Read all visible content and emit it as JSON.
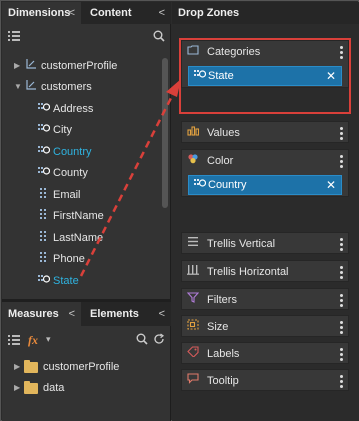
{
  "left": {
    "tabs": [
      {
        "label": "Dimensions",
        "chev": "<"
      },
      {
        "label": "Content",
        "chev": "<"
      }
    ],
    "tree": [
      {
        "label": "customerProfile",
        "icon": "dimension-icon",
        "expanded": false
      },
      {
        "label": "customers",
        "icon": "dimension-icon",
        "expanded": true
      },
      {
        "label": "Address",
        "icon": "geo-icon"
      },
      {
        "label": "City",
        "icon": "geo-icon"
      },
      {
        "label": "Country",
        "icon": "geo-icon",
        "highlight": true
      },
      {
        "label": "County",
        "icon": "geo-icon"
      },
      {
        "label": "Email",
        "icon": "field-icon"
      },
      {
        "label": "FirstName",
        "icon": "field-icon"
      },
      {
        "label": "LastName",
        "icon": "field-icon"
      },
      {
        "label": "Phone",
        "icon": "field-icon"
      },
      {
        "label": "State",
        "icon": "geo-icon",
        "highlight": true
      }
    ],
    "bottom_tabs": [
      {
        "label": "Measures",
        "chev": "<"
      },
      {
        "label": "Elements",
        "chev": "<"
      }
    ],
    "measures_toolbar": {
      "fx": "fx",
      "caret": "▾"
    },
    "folders": [
      {
        "label": "customerProfile"
      },
      {
        "label": "data"
      }
    ]
  },
  "right": {
    "title": "Drop Zones",
    "zones": [
      {
        "label": "Categories",
        "icon": "categories-icon",
        "chip": "State"
      },
      {
        "label": "Values",
        "icon": "values-icon"
      },
      {
        "label": "Color",
        "icon": "color-icon",
        "chip": "Country"
      },
      {
        "label": "Trellis Vertical",
        "icon": "trellis-vertical-icon"
      },
      {
        "label": "Trellis Horizontal",
        "icon": "trellis-horizontal-icon"
      },
      {
        "label": "Filters",
        "icon": "filter-icon"
      },
      {
        "label": "Size",
        "icon": "size-icon"
      },
      {
        "label": "Labels",
        "icon": "labels-icon"
      },
      {
        "label": "Tooltip",
        "icon": "tooltip-icon"
      }
    ]
  },
  "colors": {
    "accent": "#2fb3e0",
    "chip": "#1d72a8",
    "annotation": "#d9403a"
  }
}
